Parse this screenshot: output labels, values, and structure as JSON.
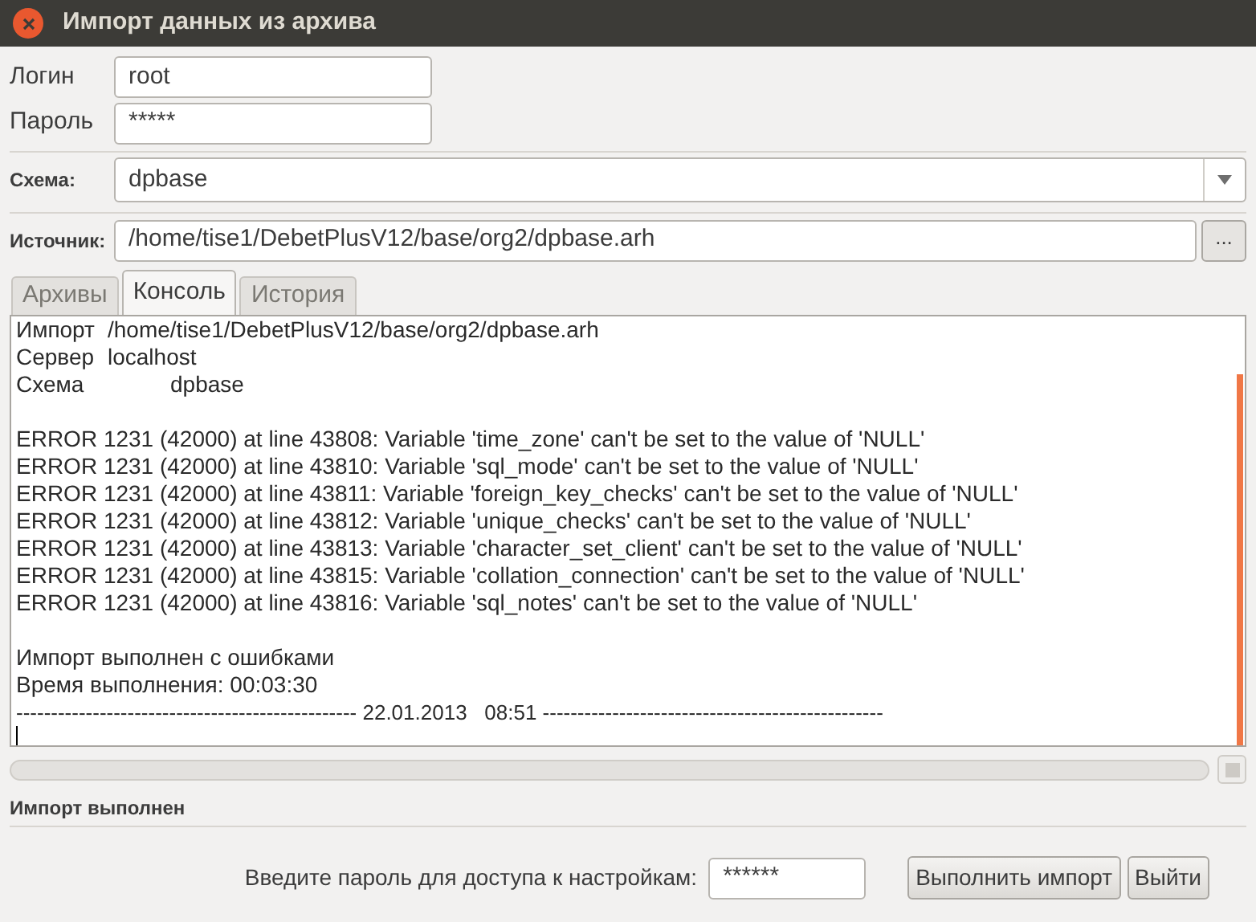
{
  "window": {
    "title": "Импорт данных из архива"
  },
  "login": {
    "label": "Логин",
    "value": "root"
  },
  "password": {
    "label": "Пароль",
    "value": "*****"
  },
  "schema": {
    "label": "Схема:",
    "value": "dpbase"
  },
  "source": {
    "label": "Источник:",
    "value": "/home/tise1/DebetPlusV12/base/org2/dpbase.arh",
    "browse": "..."
  },
  "tabs": [
    {
      "label": "Архивы",
      "selected": false
    },
    {
      "label": "Консоль",
      "selected": true
    },
    {
      "label": "История",
      "selected": false
    }
  ],
  "console": {
    "header": [
      {
        "label": "Импорт",
        "value": "/home/tise1/DebetPlusV12/base/org2/dpbase.arh"
      },
      {
        "label": "Сервер",
        "value": "localhost"
      },
      {
        "label": "Схема",
        "value": "dpbase"
      }
    ],
    "errors": [
      "ERROR 1231 (42000) at line 43808: Variable 'time_zone' can't be set to the value of 'NULL'",
      "ERROR 1231 (42000) at line 43810: Variable 'sql_mode' can't be set to the value of 'NULL'",
      "ERROR 1231 (42000) at line 43811: Variable 'foreign_key_checks' can't be set to the value of 'NULL'",
      "ERROR 1231 (42000) at line 43812: Variable 'unique_checks' can't be set to the value of 'NULL'",
      "ERROR 1231 (42000) at line 43813: Variable 'character_set_client' can't be set to the value of 'NULL'",
      "ERROR 1231 (42000) at line 43815: Variable 'collation_connection' can't be set to the value of 'NULL'",
      "ERROR 1231 (42000) at line 43816: Variable 'sql_notes' can't be set to the value of 'NULL'"
    ],
    "summary": [
      "Импорт выполнен с ошибками",
      "Время выполнения: 00:03:30"
    ],
    "separator": "------------------------------------------------- 22.01.2013   08:51 -------------------------------------------------"
  },
  "progress": {
    "level": 0
  },
  "status": "Импорт выполнен",
  "settings_password": {
    "label": "Введите пароль для доступа к настройкам:",
    "value": "******"
  },
  "buttons": [
    "Выполнить импорт",
    "Выйти"
  ]
}
